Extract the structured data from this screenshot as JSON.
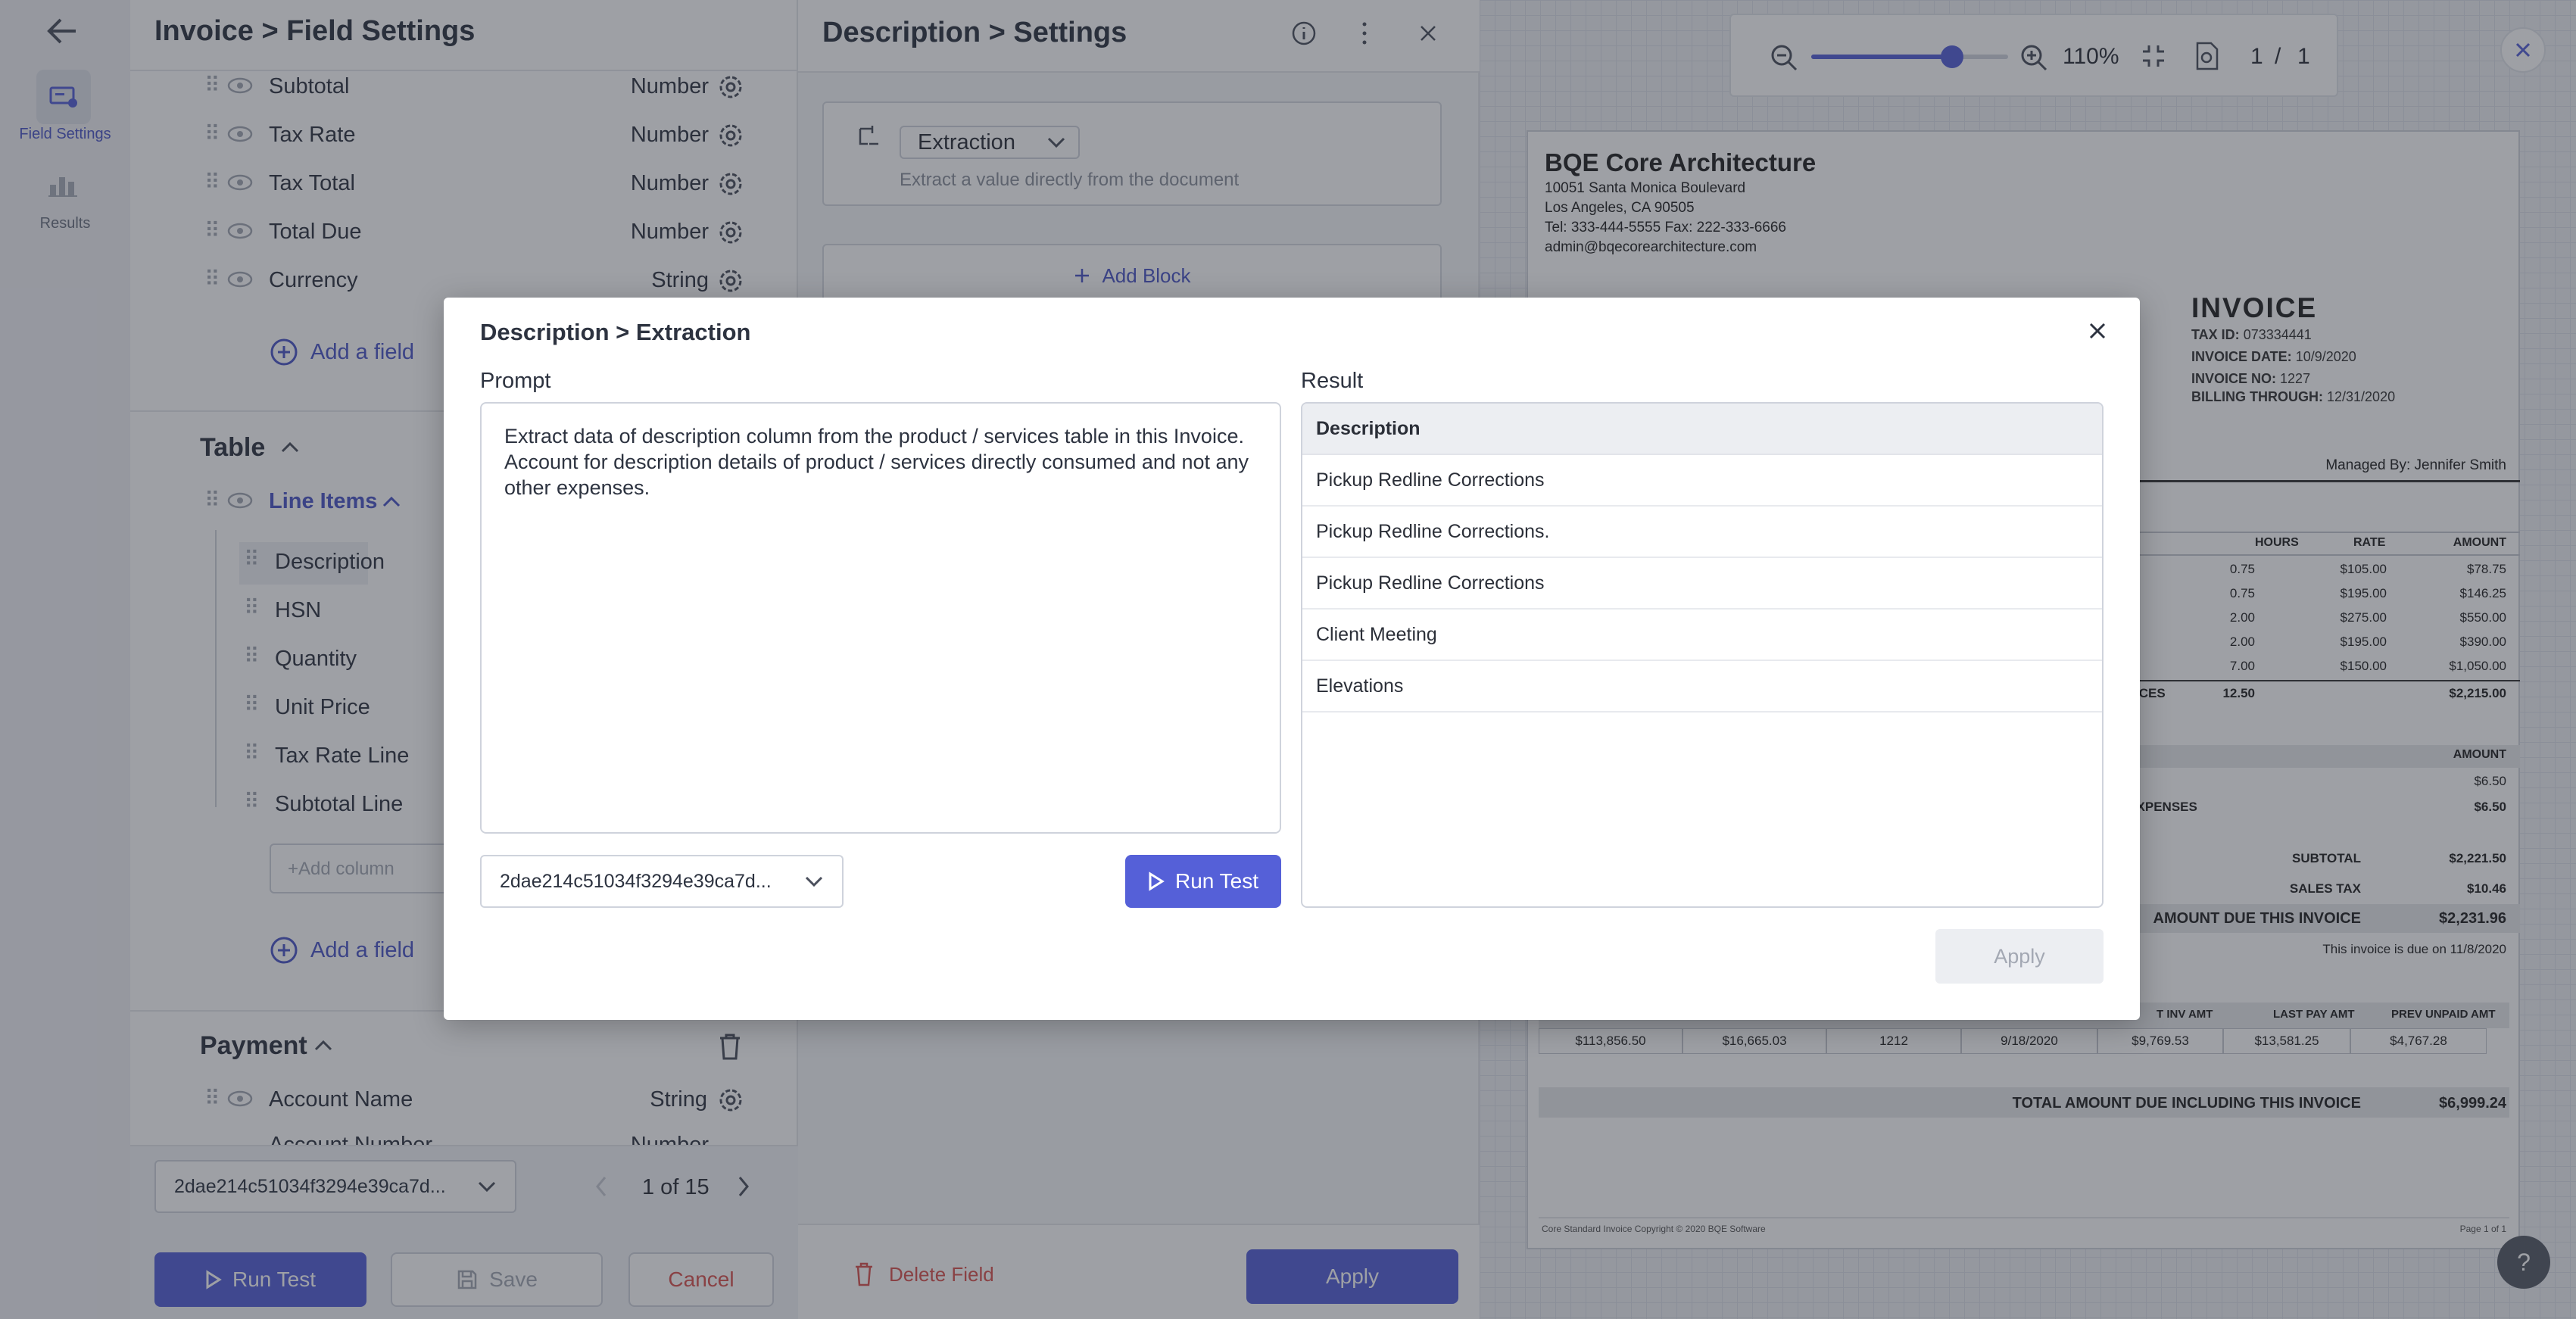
{
  "rail": {
    "items": [
      {
        "label": "Field Settings",
        "icon": "field-settings-icon",
        "active": true
      },
      {
        "label": "Results",
        "icon": "results-icon",
        "active": false
      }
    ]
  },
  "field_panel": {
    "breadcrumb": "Invoice > Field Settings",
    "header_fields": [
      {
        "label": "Subtotal",
        "type": "Number"
      },
      {
        "label": "Tax Rate",
        "type": "Number"
      },
      {
        "label": "Tax Total",
        "type": "Number"
      },
      {
        "label": "Total Due",
        "type": "Number"
      },
      {
        "label": "Currency",
        "type": "String"
      }
    ],
    "add_field": "Add a field",
    "table_section": "Table",
    "line_items": "Line Items",
    "columns": [
      "Description",
      "HSN",
      "Quantity",
      "Unit Price",
      "Tax Rate Line",
      "Subtotal Line"
    ],
    "add_column_placeholder": "+Add column",
    "payment_section": "Payment",
    "payment_fields": [
      {
        "label": "Account Name",
        "type": "String"
      },
      {
        "label": "Account Number",
        "type": "Number"
      }
    ],
    "doc_select": "2dae214c51034f3294e39ca7d...",
    "pager": "1 of 15",
    "run_test": "Run Test",
    "save": "Save",
    "cancel": "Cancel"
  },
  "settings_panel": {
    "title": "Description > Settings",
    "block_type": "Extraction",
    "block_hint": "Extract a value directly from the document",
    "add_block": "Add Block",
    "delete_field": "Delete Field",
    "apply": "Apply"
  },
  "viewer": {
    "zoom": "110%",
    "page_current": "1",
    "page_sep": "/",
    "page_total": "1",
    "help": "?"
  },
  "invoice": {
    "company": "BQE Core Architecture",
    "addr1": "10051 Santa Monica Boulevard",
    "addr2": "Los Angeles, CA 90505",
    "phone": "Tel: 333-444-5555 Fax: 222-333-6666",
    "email": "admin@bqecorearchitecture.com",
    "heading": "INVOICE",
    "tax_id_label": "TAX ID:",
    "tax_id": "073334441",
    "date_label": "INVOICE DATE:",
    "date": "10/9/2020",
    "no_label": "INVOICE NO:",
    "no": "1227",
    "billing_label": "BILLING THROUGH:",
    "billing": "12/31/2020",
    "managed_by": "Managed By: Jennifer  Smith",
    "cols": [
      "HOURS",
      "RATE",
      "AMOUNT"
    ],
    "rows": [
      [
        "0.75",
        "$105.00",
        "$78.75"
      ],
      [
        "0.75",
        "$195.00",
        "$146.25"
      ],
      [
        "2.00",
        "$275.00",
        "$550.00"
      ],
      [
        "2.00",
        "$195.00",
        "$390.00"
      ],
      [
        "7.00",
        "$150.00",
        "$1,050.00"
      ]
    ],
    "services_label": "SERVICES",
    "services_hours": "12.50",
    "services_total": "$2,215.00",
    "exp_amount_head": "AMOUNT",
    "exp_amount": "$6.50",
    "exp_total_label": "TAL EXPENSES",
    "exp_total": "$6.50",
    "subtotal_label": "SUBTOTAL",
    "subtotal": "$2,221.50",
    "sales_tax_label": "SALES TAX",
    "sales_tax": "$10.46",
    "due_label": "AMOUNT DUE THIS INVOICE",
    "due": "$2,231.96",
    "due_note": "This invoice is due on 11/8/2020",
    "hist_cols": [
      "T INV AMT",
      "LAST PAY AMT",
      "PREV UNPAID AMT"
    ],
    "hist_row": [
      "$113,856.50",
      "$16,665.03",
      "1212",
      "9/18/2020",
      "$9,769.53",
      "$13,581.25",
      "$4,767.28"
    ],
    "grand_label": "TOTAL AMOUNT DUE INCLUDING THIS INVOICE",
    "grand": "$6,999.24",
    "footer_left": "Core Standard Invoice Copyright © 2020 BQE Software",
    "footer_right": "Page 1 of 1"
  },
  "modal": {
    "title": "Description > Extraction",
    "prompt_label": "Prompt",
    "prompt_text": "Extract data of description column from the product / services table in this Invoice. Account for description details of product / services directly consumed and not any other expenses.",
    "result_label": "Result",
    "result_header": "Description",
    "results": [
      "Pickup Redline Corrections",
      "Pickup Redline Corrections.",
      "Pickup Redline Corrections",
      "Client Meeting",
      "Elevations"
    ],
    "doc_select": "2dae214c51034f3294e39ca7d...",
    "run_test": "Run Test",
    "apply": "Apply"
  },
  "colors": {
    "accent": "#5560d8",
    "link": "#4c57c7",
    "danger": "#d9534f"
  }
}
